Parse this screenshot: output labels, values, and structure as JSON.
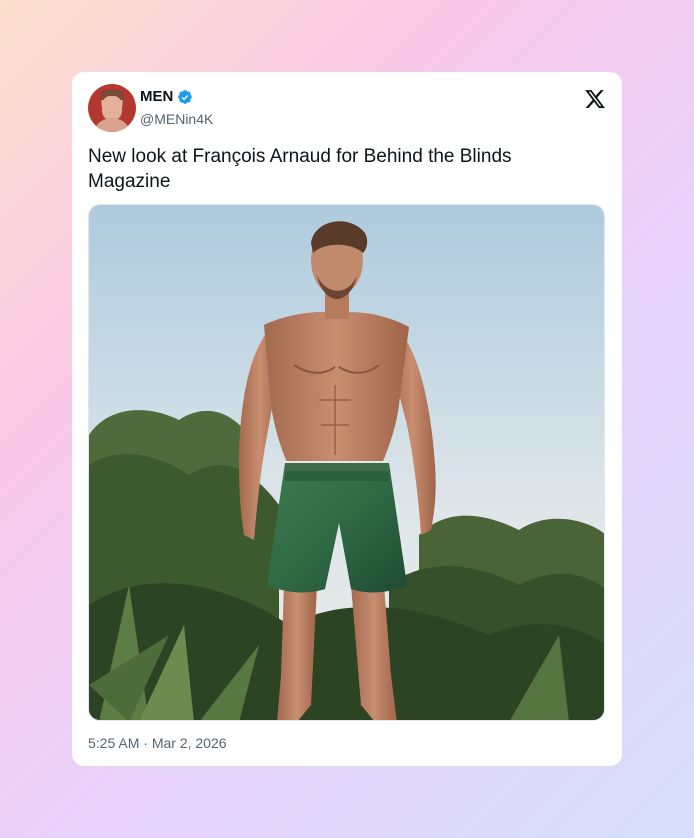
{
  "tweet": {
    "author_name": "MEN",
    "author_handle": "@MENin4K",
    "text": "New look at François Arnaud for Behind the Blinds Magazine",
    "time": "5:25 AM",
    "separator": "·",
    "date": "Mar 2, 2026",
    "verified": true,
    "icons": {
      "verified": "verified-badge-icon",
      "platform": "x-logo-icon"
    },
    "photo": {
      "kind": "photo",
      "alt": "New look at François Arnaud for Behind the Blinds Magazine"
    }
  },
  "colors": {
    "verified_blue": "#1d9bf0",
    "text_primary": "#0f1419",
    "text_secondary": "#536471"
  }
}
